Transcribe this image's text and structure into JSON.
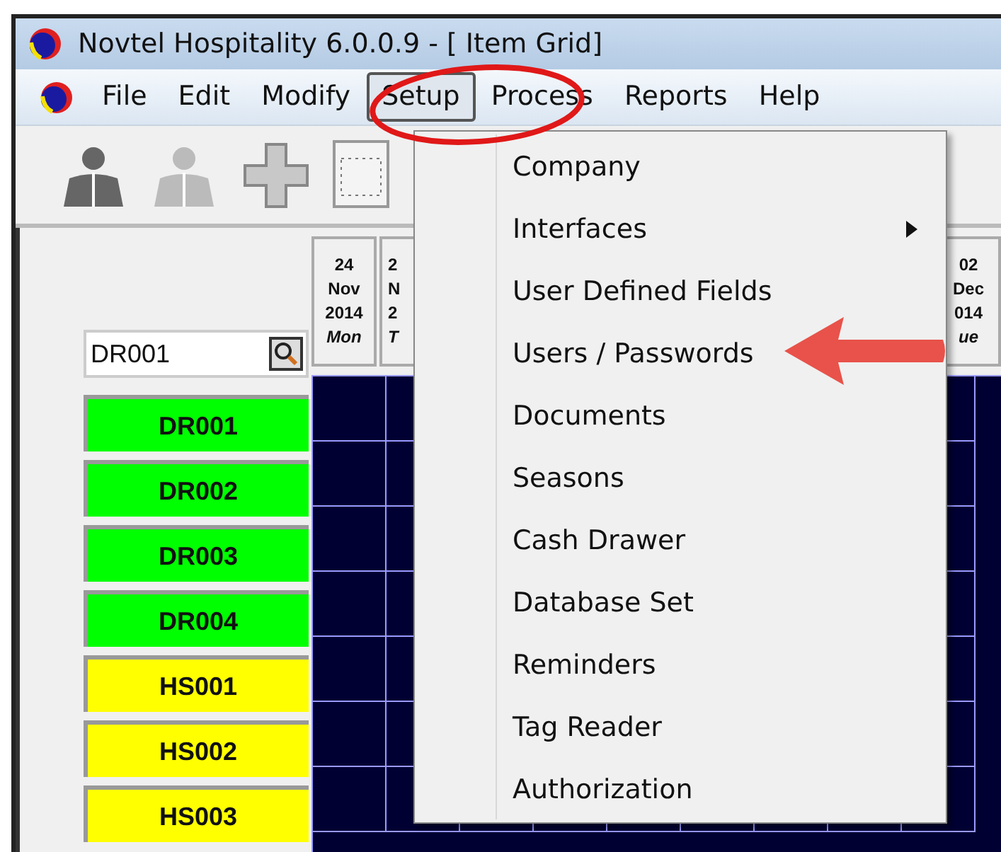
{
  "window": {
    "title": "Novtel Hospitality 6.0.0.9 - [ Item Grid]"
  },
  "menu": [
    {
      "label": "File",
      "selected": false
    },
    {
      "label": "Edit",
      "selected": false
    },
    {
      "label": "Modify",
      "selected": false
    },
    {
      "label": "Setup",
      "selected": true
    },
    {
      "label": "Process",
      "selected": false
    },
    {
      "label": "Reports",
      "selected": false
    },
    {
      "label": "Help",
      "selected": false
    }
  ],
  "search": {
    "value": "DR001"
  },
  "date_headers": [
    {
      "lines": [
        "24",
        "Nov",
        "2014",
        "Mon"
      ]
    },
    {
      "lines": [
        "2",
        "N",
        "2",
        "T"
      ]
    },
    {
      "lines": [
        "02",
        "Dec",
        "014",
        "ue"
      ]
    }
  ],
  "items": [
    {
      "label": "DR001",
      "color": "#00ff00"
    },
    {
      "label": "DR002",
      "color": "#00ff00"
    },
    {
      "label": "DR003",
      "color": "#00ff00"
    },
    {
      "label": "DR004",
      "color": "#00ff00"
    },
    {
      "label": "HS001",
      "color": "#ffff00"
    },
    {
      "label": "HS002",
      "color": "#ffff00"
    },
    {
      "label": "HS003",
      "color": "#ffff00"
    }
  ],
  "setup_menu": [
    {
      "label": "Company",
      "submenu": false
    },
    {
      "label": "Interfaces",
      "submenu": true
    },
    {
      "label": "User Defined Fields",
      "submenu": false
    },
    {
      "label": "Users / Passwords",
      "submenu": false
    },
    {
      "label": "Documents",
      "submenu": false
    },
    {
      "label": "Seasons",
      "submenu": false
    },
    {
      "label": "Cash Drawer",
      "submenu": false
    },
    {
      "label": "Database Set",
      "submenu": false
    },
    {
      "label": "Reminders",
      "submenu": false
    },
    {
      "label": "Tag Reader",
      "submenu": false
    },
    {
      "label": "Authorization",
      "submenu": false
    }
  ]
}
